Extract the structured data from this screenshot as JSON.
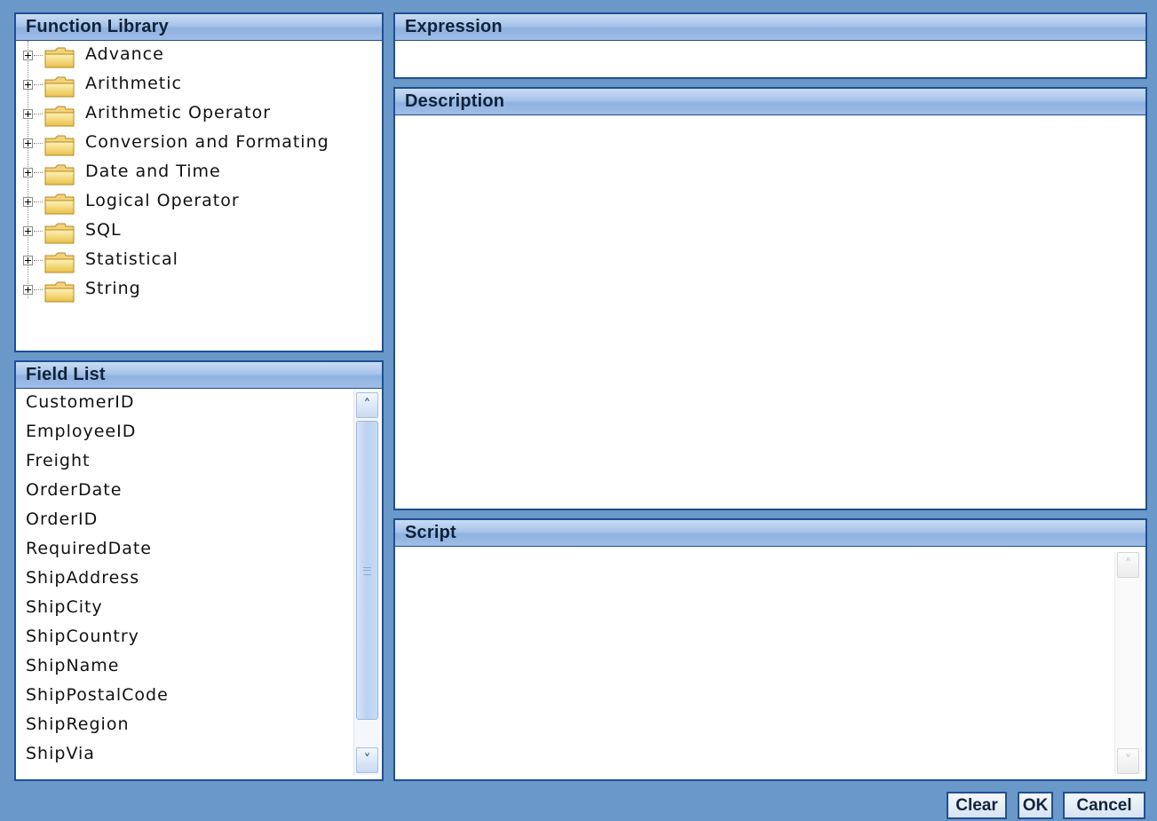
{
  "function_library": {
    "title": "Function Library",
    "items": [
      {
        "label": "Advance"
      },
      {
        "label": "Arithmetic"
      },
      {
        "label": "Arithmetic Operator"
      },
      {
        "label": "Conversion and Formating"
      },
      {
        "label": "Date and Time"
      },
      {
        "label": "Logical Operator"
      },
      {
        "label": "SQL"
      },
      {
        "label": "Statistical"
      },
      {
        "label": "String"
      }
    ]
  },
  "field_list": {
    "title": "Field List",
    "items": [
      "CustomerID",
      "EmployeeID",
      "Freight",
      "OrderDate",
      "OrderID",
      "RequiredDate",
      "ShipAddress",
      "ShipCity",
      "ShipCountry",
      "ShipName",
      "ShipPostalCode",
      "ShipRegion",
      "ShipVia"
    ]
  },
  "expression": {
    "title": "Expression",
    "value": ""
  },
  "description": {
    "title": "Description",
    "value": ""
  },
  "script": {
    "title": "Script",
    "value": ""
  },
  "buttons": {
    "clear": "Clear",
    "ok": "OK",
    "cancel": "Cancel"
  },
  "icons": {
    "tree_node": "folder-icon",
    "expander": "plus-expander-icon"
  },
  "colors": {
    "background": "#6a98c8",
    "border": "#1f4f94",
    "header": "#a7c3ea"
  }
}
